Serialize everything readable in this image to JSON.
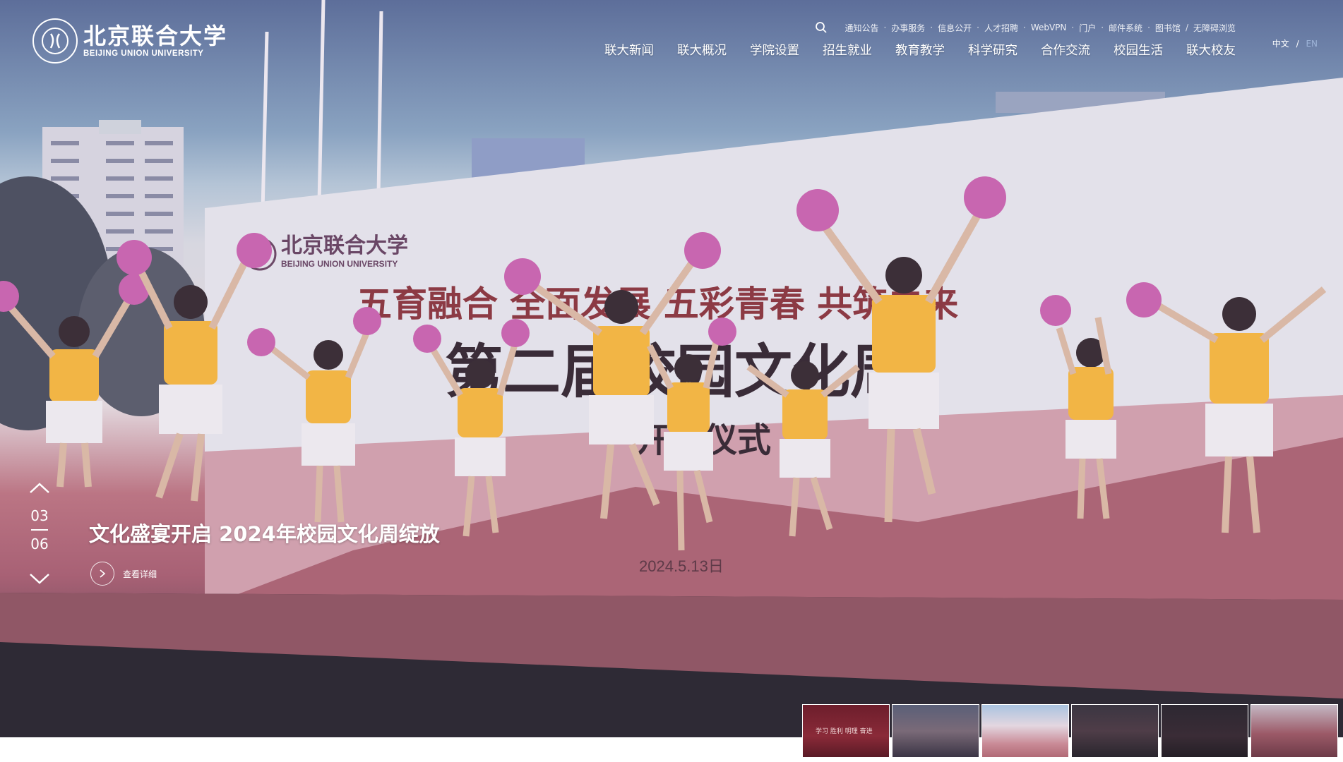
{
  "header": {
    "logo_cn": "北京联合大学",
    "logo_en": "BEIJING UNION UNIVERSITY",
    "utility_links": [
      "通知公告",
      "办事服务",
      "信息公开",
      "人才招聘",
      "WebVPN",
      "门户",
      "邮件系统",
      "图书馆"
    ],
    "utility_separator": "·",
    "accessibility_sep": "/",
    "accessibility_label": "无障碍浏览",
    "nav": [
      "联大新闻",
      "联大概况",
      "学院设置",
      "招生就业",
      "教育教学",
      "科学研究",
      "合作交流",
      "校园生活",
      "联大校友"
    ],
    "lang": {
      "zh": "中文",
      "sep": "/",
      "en": "EN"
    }
  },
  "hero": {
    "banner_logo_cn": "北京联合大学",
    "banner_logo_en": "BEIJING UNION UNIVERSITY",
    "banner_slogan": "五育融合 全面发展 五彩青春 共筑未来",
    "banner_title": "第二届校园文化周",
    "banner_subtitle": "开幕仪式",
    "banner_date": "2024.5.13日"
  },
  "slide": {
    "caption": "文化盛宴开启 2024年校园文化周绽放",
    "detail_label": "查看详细",
    "current": "03",
    "total": "06"
  },
  "thumbnails": {
    "count": 6,
    "first_overlay": "学习 胜利 明理 奋进"
  },
  "colors": {
    "shirt": "#f2b545",
    "pompom": "#c866b0",
    "stage": "#a55f6e",
    "banner_text": "#8c3a44"
  },
  "icons": [
    "search-icon",
    "chevron-up-icon",
    "chevron-down-icon",
    "chevron-right-icon",
    "university-emblem-icon"
  ]
}
